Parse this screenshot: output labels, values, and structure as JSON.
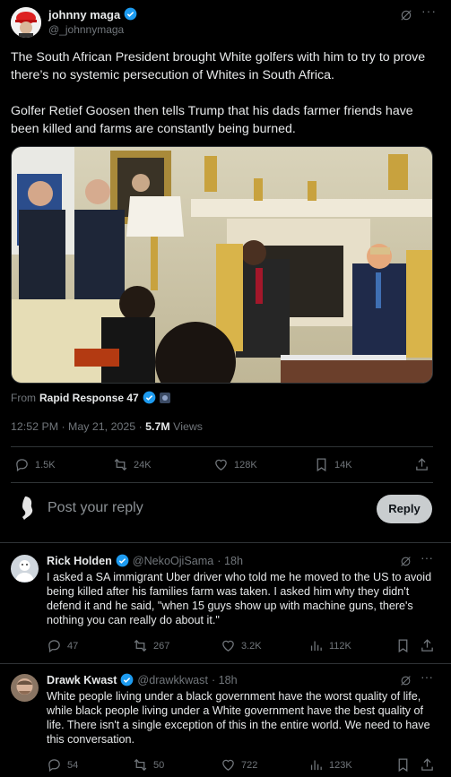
{
  "main_post": {
    "author_name": "johnny maga",
    "author_handle": "@_johnnymaga",
    "text_p1": "The South African President brought White golfers with him to try to prove there’s no systemic persecution of Whites in South Africa.",
    "text_p2": "Golfer Retief Goosen then tells Trump that his dads farmer friends have been killed and farms are constantly being burned.",
    "source_prefix": "From",
    "source_name": "Rapid Response 47",
    "timestamp": "12:52 PM · May 21, 2025 ·",
    "views_count": "5.7M",
    "views_label": "Views",
    "stats": {
      "replies": "1.5K",
      "reposts": "24K",
      "likes": "128K",
      "bookmarks": "14K"
    }
  },
  "composer": {
    "placeholder": "Post your reply",
    "button_label": "Reply"
  },
  "replies": [
    {
      "name": "Rick Holden",
      "handle": "@NekoOjiSama",
      "time": "· 18h",
      "text": "I asked a SA immigrant Uber driver who told me he moved to the US to avoid being killed after his families farm was taken. I asked him why they didn't defend it and he said, \"when 15 guys show up with machine guns, there's nothing you can really do about it.\"",
      "replies": "47",
      "reposts": "267",
      "likes": "3.2K",
      "views": "112K"
    },
    {
      "name": "Drawk Kwast",
      "handle": "@drawkkwast",
      "time": "· 18h",
      "text": "White people living under a black government have the worst quality of life, while black people living under a White government have the best quality of life.  There isn't a single exception of this in the entire world.  We need to have this conversation.",
      "replies": "54",
      "reposts": "50",
      "likes": "722",
      "views": "123K"
    }
  ],
  "colors": {
    "background": "#000000",
    "text": "#e7e9ea",
    "muted": "#71767b",
    "accent": "#1d9bf0",
    "divider": "#2f3336"
  }
}
